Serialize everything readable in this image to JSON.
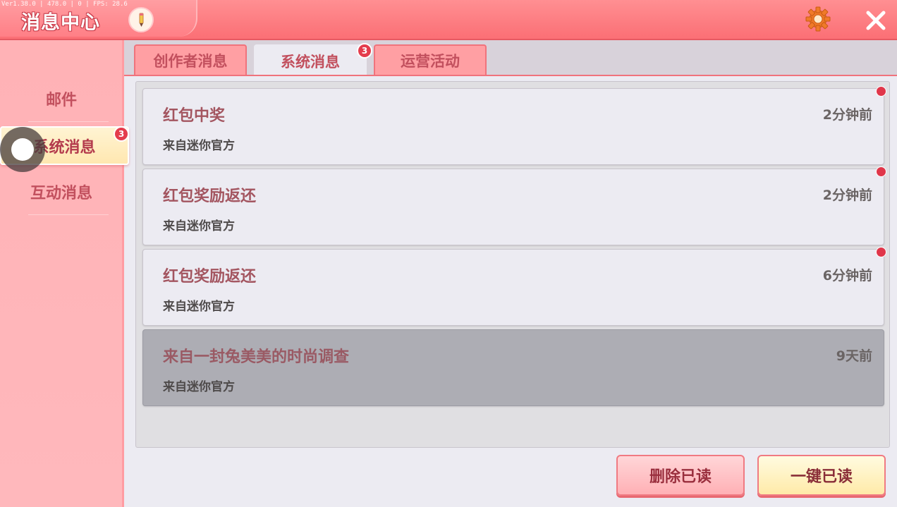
{
  "header": {
    "version": "Ver1.38.0 | 478.0 | 0 | FPS: 28.6",
    "title": "消息中心",
    "icons": {
      "edit": "pencil-icon",
      "settings": "gear-icon",
      "close": "close-icon"
    },
    "colors": {
      "bar": "#fb6f75",
      "accent": "#e43c4c"
    }
  },
  "sidebar": {
    "items": [
      {
        "label": "邮件",
        "active": false
      },
      {
        "label": "系统消息",
        "active": true,
        "badge": "3"
      },
      {
        "label": "互动消息",
        "active": false
      }
    ]
  },
  "tabs": [
    {
      "label": "创作者消息",
      "active": false
    },
    {
      "label": "系统消息",
      "active": true,
      "badge": "3"
    },
    {
      "label": "运营活动",
      "active": false
    }
  ],
  "messages": [
    {
      "title": "红包中奖",
      "sender": "来自迷你官方",
      "time": "2分钟前",
      "unread": true
    },
    {
      "title": "红包奖励返还",
      "sender": "来自迷你官方",
      "time": "2分钟前",
      "unread": true
    },
    {
      "title": "红包奖励返还",
      "sender": "来自迷你官方",
      "time": "6分钟前",
      "unread": true
    },
    {
      "title": "来自一封兔美美的时尚调查",
      "sender": "来自迷你官方",
      "time": "9天前",
      "unread": false
    }
  ],
  "buttons": {
    "delete_read": "删除已读",
    "read_all": "一键已读"
  }
}
